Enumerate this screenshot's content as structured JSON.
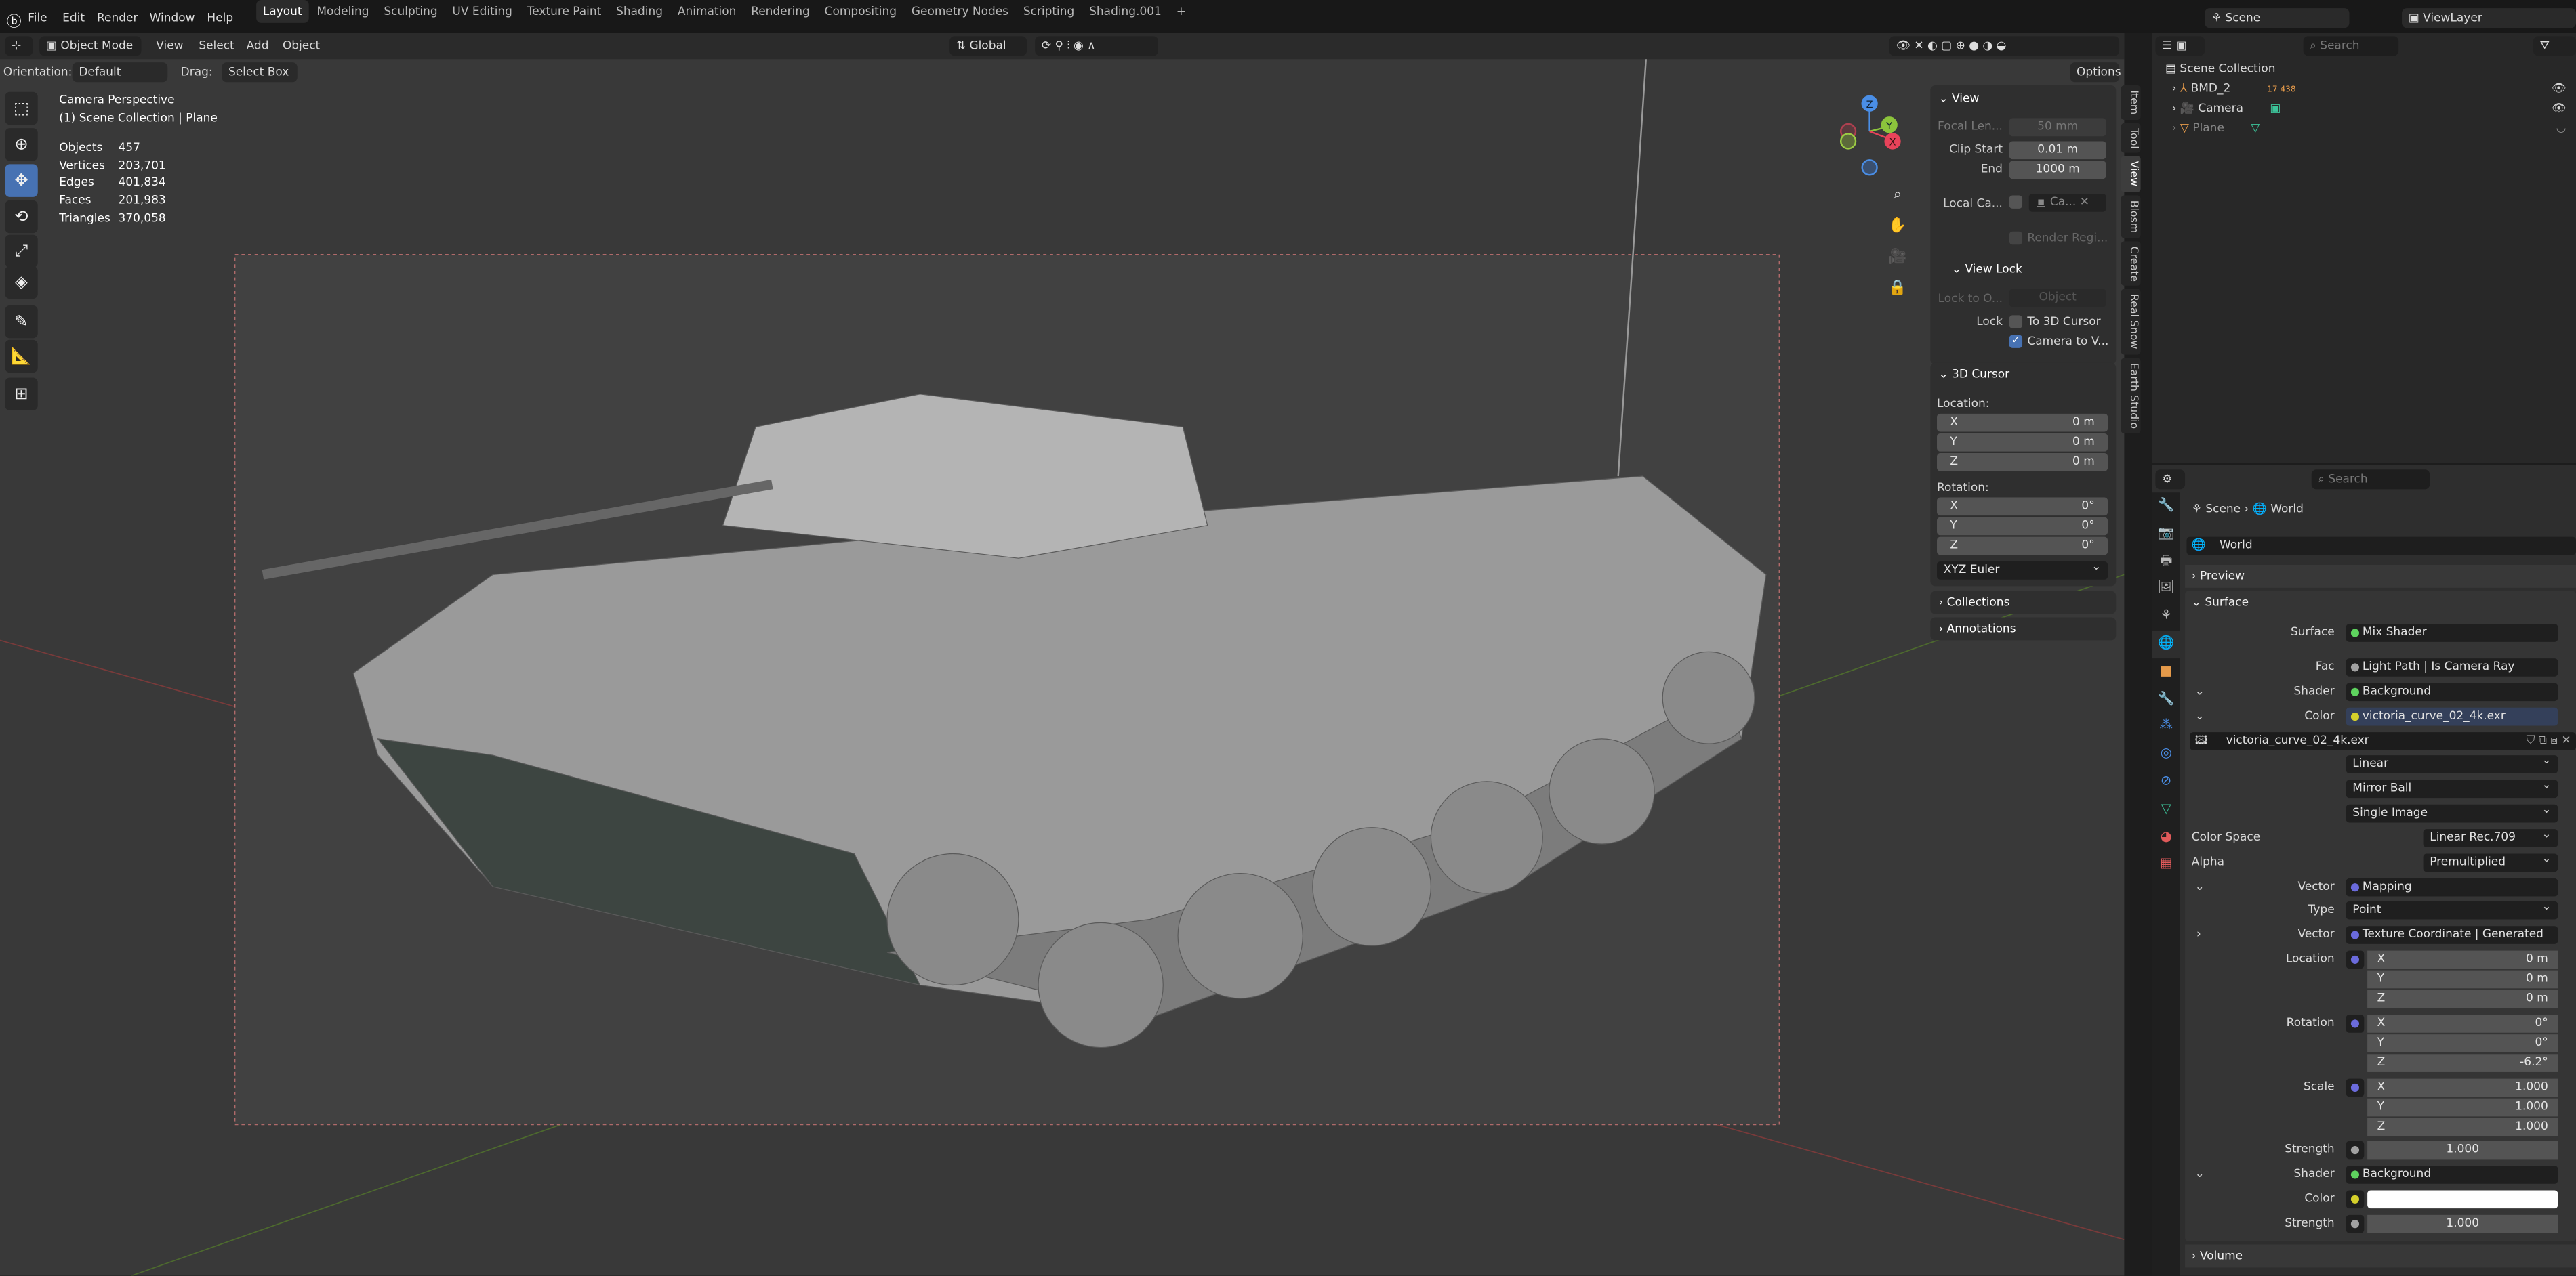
{
  "menu": {
    "items": [
      "File",
      "Edit",
      "Render",
      "Window",
      "Help"
    ]
  },
  "workspaces": [
    "Layout",
    "Modeling",
    "Sculpting",
    "UV Editing",
    "Texture Paint",
    "Shading",
    "Animation",
    "Rendering",
    "Compositing",
    "Geometry Nodes",
    "Scripting",
    "Shading.001"
  ],
  "scene": {
    "name": "Scene",
    "view_layer": "ViewLayer"
  },
  "header": {
    "mode": "Object Mode",
    "menus": [
      "View",
      "Select",
      "Add",
      "Object"
    ],
    "transform": "Global",
    "options": "Options",
    "orientation_label": "Orientation:",
    "orientation": "Default",
    "drag_label": "Drag:",
    "drag": "Select Box"
  },
  "overlay": {
    "title": "Camera Perspective",
    "subtitle": "(1) Scene Collection | Plane",
    "stats": [
      {
        "k": "Objects",
        "v": "457"
      },
      {
        "k": "Vertices",
        "v": "203,701"
      },
      {
        "k": "Edges",
        "v": "401,834"
      },
      {
        "k": "Faces",
        "v": "201,983"
      },
      {
        "k": "Triangles",
        "v": "370,058"
      }
    ]
  },
  "gizmo": {
    "z": "Z",
    "y": "Y",
    "x": "X"
  },
  "npanel": {
    "view_title": "View",
    "focal_label": "Focal Len...",
    "focal": "50 mm",
    "clip_start_label": "Clip Start",
    "clip_start": "0.01 m",
    "end_label": "End",
    "end": "1000 m",
    "local_cam_label": "Local Ca...",
    "local_cam": "Ca...",
    "render_region": "Render Regi...",
    "view_lock": "View Lock",
    "lock_to_label": "Lock to O...",
    "lock_to": "Object",
    "lock_label": "Lock",
    "to_cursor": "To 3D Cursor",
    "camera_to_view": "Camera to V...",
    "cursor_title": "3D Cursor",
    "location_label": "Location:",
    "rotation_label": "Rotation:",
    "loc": [
      {
        "a": "X",
        "v": "0 m"
      },
      {
        "a": "Y",
        "v": "0 m"
      },
      {
        "a": "Z",
        "v": "0 m"
      }
    ],
    "rot": [
      {
        "a": "X",
        "v": "0°"
      },
      {
        "a": "Y",
        "v": "0°"
      },
      {
        "a": "Z",
        "v": "0°"
      }
    ],
    "rot_mode": "XYZ Euler",
    "collections": "Collections",
    "annotations": "Annotations"
  },
  "tabs": [
    "Item",
    "Tool",
    "View",
    "Blosm",
    "Create",
    "Real Snow",
    "Earth Studio"
  ],
  "outliner": {
    "search": "Search",
    "root": "Scene Collection",
    "items": [
      {
        "name": "BMD_2",
        "badge": "17 438"
      },
      {
        "name": "Camera"
      },
      {
        "name": "Plane"
      }
    ]
  },
  "props": {
    "search": "Search",
    "breadcrumb": [
      "Scene",
      "World"
    ],
    "world": "World",
    "preview": "Preview",
    "surface_panel": "Surface",
    "volume": "Volume",
    "rows": {
      "surface": {
        "l": "Surface",
        "v": "Mix Shader"
      },
      "fac": {
        "l": "Fac",
        "v": "Light Path | Is Camera Ray"
      },
      "shader": {
        "l": "Shader",
        "v": "Background"
      },
      "color": {
        "l": "Color",
        "v": "victoria_curve_02_4k.exr"
      },
      "image": "victoria_curve_02_4k.exr",
      "interp": "Linear",
      "proj": "Mirror Ball",
      "source": "Single Image",
      "colorspace": {
        "l": "Color Space",
        "v": "Linear Rec.709"
      },
      "alpha": {
        "l": "Alpha",
        "v": "Premultiplied"
      },
      "vector": {
        "l": "Vector",
        "v": "Mapping"
      },
      "type": {
        "l": "Type",
        "v": "Point"
      },
      "vector2": {
        "l": "Vector",
        "v": "Texture Coordinate | Generated"
      },
      "location": {
        "l": "Location",
        "x": "0 m",
        "y": "0 m",
        "z": "0 m"
      },
      "rotation": {
        "l": "Rotation",
        "x": "0°",
        "y": "0°",
        "z": "-6.2°"
      },
      "scale": {
        "l": "Scale",
        "x": "1.000",
        "y": "1.000",
        "z": "1.000"
      },
      "strength": {
        "l": "Strength",
        "v": "1.000"
      },
      "shader2": {
        "l": "Shader",
        "v": "Background"
      },
      "color2": {
        "l": "Color",
        "v": "#ffffff"
      },
      "strength2": {
        "l": "Strength",
        "v": "1.000"
      }
    }
  },
  "colors": {
    "accent": "#4772b3",
    "shader_socket": "#5ed35e",
    "color_socket": "#d4cf2a",
    "vector_socket": "#6b6bdc",
    "float_socket": "#a1a1a1"
  }
}
